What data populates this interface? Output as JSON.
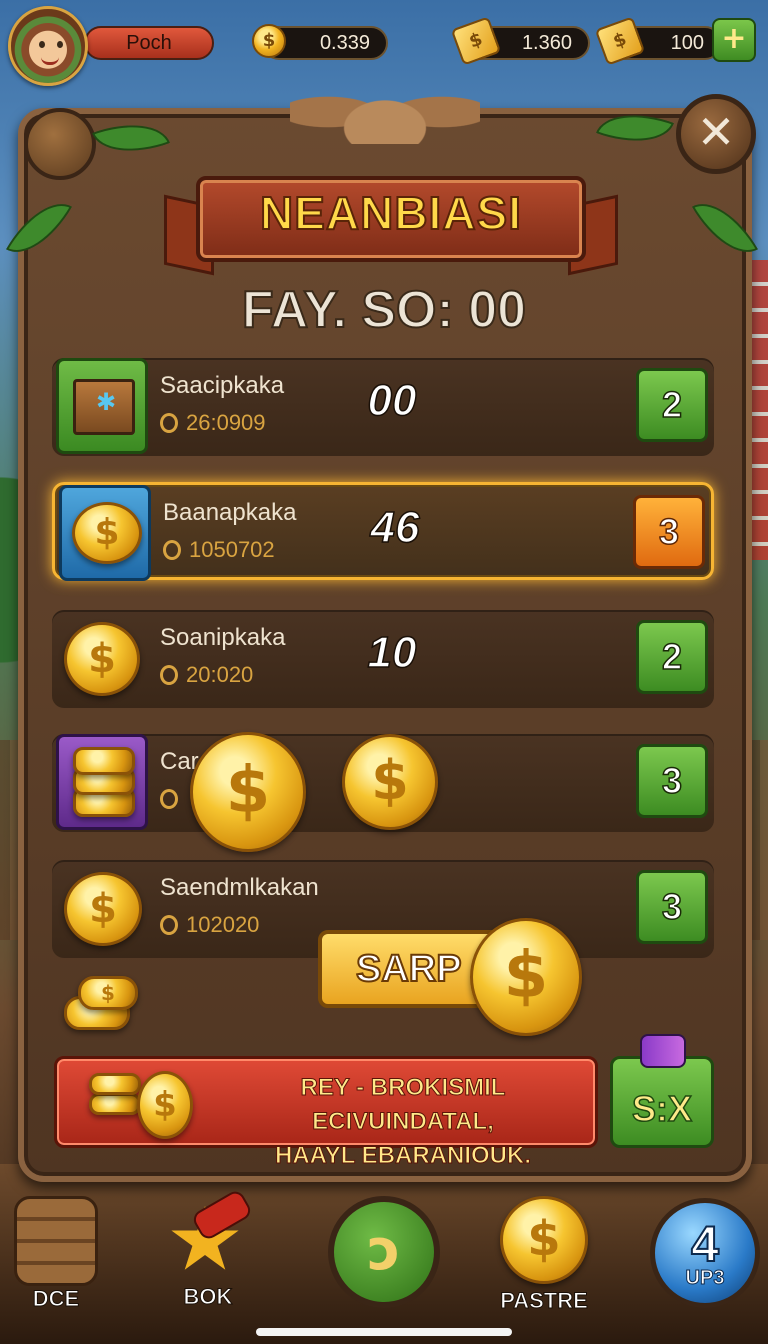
{
  "hud": {
    "player_name": "Poch",
    "coins": "0.339",
    "tickets": "1.360",
    "gems": "100",
    "plus_label": "+"
  },
  "panel": {
    "title": "NEANBIASI",
    "timer": "FAY. SO: 00",
    "close_label": "✕"
  },
  "rows": [
    {
      "label": "Saacipkaka",
      "sub": "26:0909",
      "qty": "00",
      "button": "2",
      "icon": "crate-icon",
      "tile": "green"
    },
    {
      "label": "Baanapkaka",
      "sub": "1050702",
      "qty": "46",
      "button": "3",
      "icon": "coin-icon",
      "tile": "blue",
      "highlight": true
    },
    {
      "label": "Soanipkaka",
      "sub": "20:020",
      "qty": "10",
      "button": "2",
      "icon": "coin-icon",
      "tile": "none"
    },
    {
      "label": "Car",
      "sub": "",
      "qty": "",
      "button": "3",
      "icon": "coin-stack-icon",
      "tile": "purple"
    },
    {
      "label": "Saendmlkakan",
      "sub": "102020",
      "qty": "",
      "button": "3",
      "icon": "coin-icon",
      "tile": "none"
    }
  ],
  "sarp_label": "SARP",
  "promo": {
    "line1": "REY - BROKISMIL ECIVUINDATAL,",
    "line2": "HAAYL EBARANIOUK.",
    "button": "S:X"
  },
  "nav": {
    "item1": "DCE",
    "item2": "BOK",
    "item4": "PASTRE",
    "bubble_num": "4",
    "bubble_sub": "UP3"
  },
  "colors": {
    "accent_gold": "#f2b320",
    "button_green": "#3d8c22",
    "button_orange": "#e06a10",
    "promo_red": "#a82618",
    "panel_wood": "#4f3522"
  }
}
